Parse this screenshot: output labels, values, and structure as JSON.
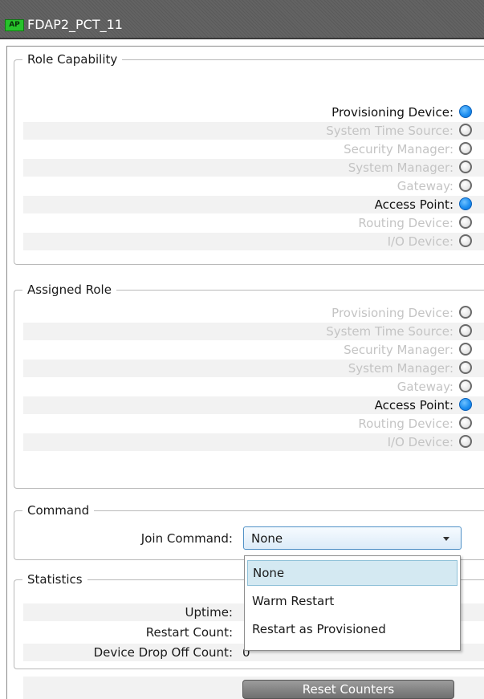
{
  "header": {
    "badge": "AP",
    "title": "FDAP2_PCT_11"
  },
  "role_capability": {
    "title": "Role Capability",
    "rows": [
      {
        "label": "Provisioning Device:",
        "enabled": true,
        "indicator": "blue"
      },
      {
        "label": "System Time Source:",
        "enabled": false,
        "indicator": "empty"
      },
      {
        "label": "Security Manager:",
        "enabled": false,
        "indicator": "empty"
      },
      {
        "label": "System Manager:",
        "enabled": false,
        "indicator": "empty"
      },
      {
        "label": "Gateway:",
        "enabled": false,
        "indicator": "empty"
      },
      {
        "label": "Access Point:",
        "enabled": true,
        "indicator": "blue"
      },
      {
        "label": "Routing Device:",
        "enabled": false,
        "indicator": "empty"
      },
      {
        "label": "I/O Device:",
        "enabled": false,
        "indicator": "empty"
      }
    ]
  },
  "assigned_role": {
    "title": "Assigned Role",
    "rows": [
      {
        "label": "Provisioning Device:",
        "enabled": false,
        "indicator": "empty"
      },
      {
        "label": "System Time Source:",
        "enabled": false,
        "indicator": "empty"
      },
      {
        "label": "Security Manager:",
        "enabled": false,
        "indicator": "empty"
      },
      {
        "label": "System Manager:",
        "enabled": false,
        "indicator": "empty"
      },
      {
        "label": "Gateway:",
        "enabled": false,
        "indicator": "empty"
      },
      {
        "label": "Access Point:",
        "enabled": true,
        "indicator": "blue"
      },
      {
        "label": "Routing Device:",
        "enabled": false,
        "indicator": "empty"
      },
      {
        "label": "I/O Device:",
        "enabled": false,
        "indicator": "empty"
      }
    ]
  },
  "command": {
    "title": "Command",
    "join_label": "Join Command:",
    "selected": "None",
    "options": [
      "None",
      "Warm Restart",
      "Restart as Provisioned"
    ],
    "highlighted_index": 0
  },
  "statistics": {
    "title": "Statistics",
    "uptime_label": "Uptime:",
    "restart_label": "Restart Count:",
    "dropoff_label": "Device Drop Off Count:",
    "dropoff_value": "0"
  },
  "reset_button": "Reset Counters",
  "icons": {
    "dropdown": "chevron-down-icon",
    "indicator": "status-dot-icon"
  },
  "colors": {
    "accent": "#1e8ff0",
    "badge": "#27c22b",
    "header_bg": "#5a5a5a"
  }
}
